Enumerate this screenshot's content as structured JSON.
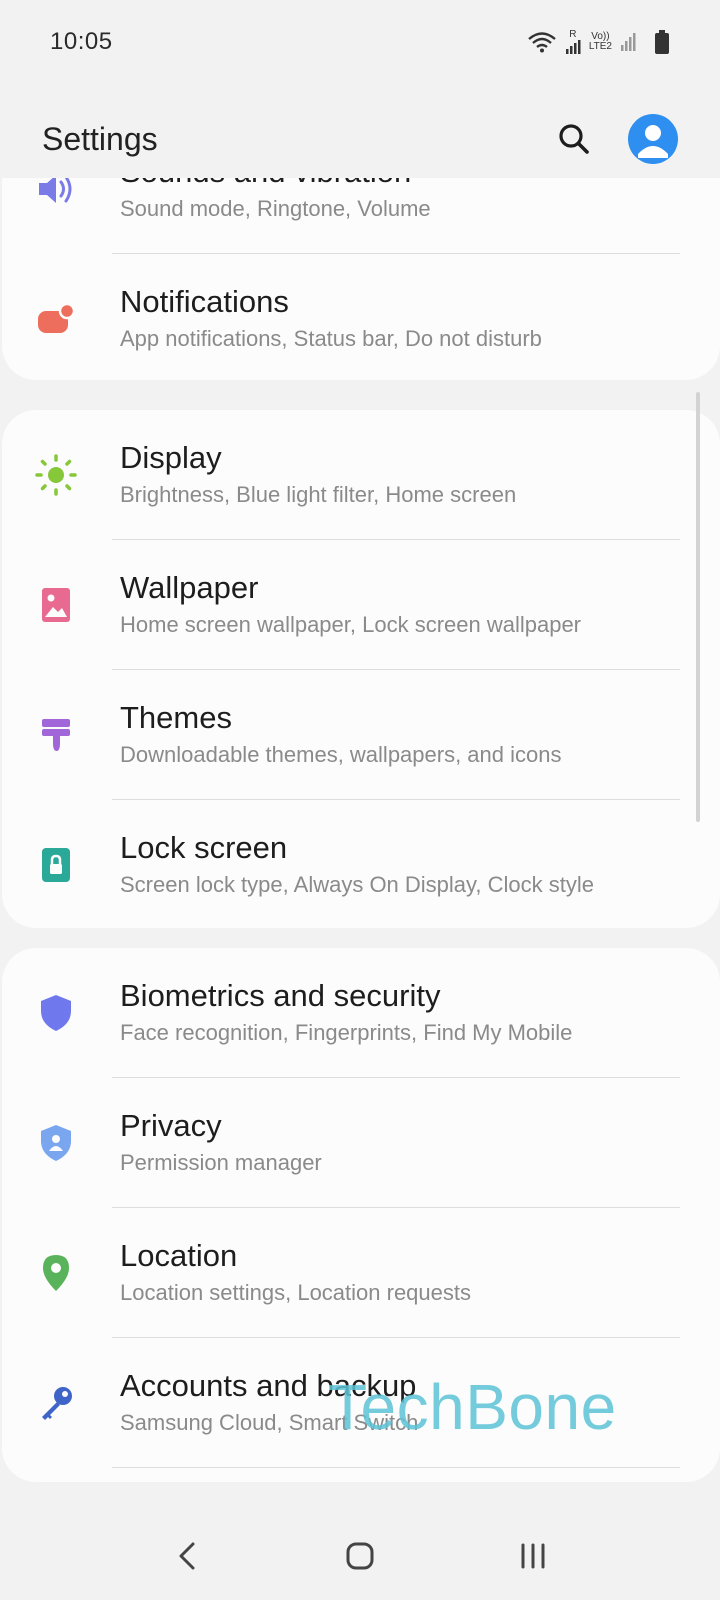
{
  "status_bar": {
    "time": "10:05",
    "sim1_label": "R",
    "volte_top": "Vo))",
    "volte_bottom": "LTE2"
  },
  "app_bar": {
    "title": "Settings"
  },
  "cards": [
    {
      "items": [
        {
          "title": "Sounds and vibration",
          "subtitle": "Sound mode, Ringtone, Volume",
          "icon": "volume-icon",
          "color": "#7b7be8"
        },
        {
          "title": "Notifications",
          "subtitle": "App notifications, Status bar, Do not disturb",
          "icon": "notification-icon",
          "color": "#ee6e5e"
        }
      ]
    },
    {
      "items": [
        {
          "title": "Display",
          "subtitle": "Brightness, Blue light filter, Home screen",
          "icon": "brightness-icon",
          "color": "#86c83a"
        },
        {
          "title": "Wallpaper",
          "subtitle": "Home screen wallpaper, Lock screen wallpaper",
          "icon": "wallpaper-icon",
          "color": "#e96a91"
        },
        {
          "title": "Themes",
          "subtitle": "Downloadable themes, wallpapers, and icons",
          "icon": "theme-brush-icon",
          "color": "#a166d8"
        },
        {
          "title": "Lock screen",
          "subtitle": "Screen lock type, Always On Display, Clock style",
          "icon": "lock-icon",
          "color": "#2aa898"
        }
      ]
    },
    {
      "items": [
        {
          "title": "Biometrics and security",
          "subtitle": "Face recognition, Fingerprints, Find My Mobile",
          "icon": "shield-icon",
          "color": "#6f78ec"
        },
        {
          "title": "Privacy",
          "subtitle": "Permission manager",
          "icon": "privacy-shield-icon",
          "color": "#7aa6f0"
        },
        {
          "title": "Location",
          "subtitle": "Location settings, Location requests",
          "icon": "location-pin-icon",
          "color": "#58b35a"
        },
        {
          "title": "Accounts and backup",
          "subtitle": "Samsung Cloud, Smart Switch",
          "icon": "key-icon",
          "color": "#3f64c8"
        }
      ]
    }
  ],
  "watermark": {
    "text": "TechBone"
  },
  "colors": {
    "accent": "#2e8ff0",
    "background": "#f2f2f2",
    "card": "#fcfcfc"
  }
}
